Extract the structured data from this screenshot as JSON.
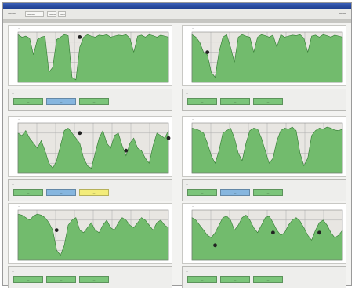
{
  "window": {
    "toolbar": {
      "label": "——",
      "dropdown": "——",
      "button1": "——",
      "button2": "——",
      "right_label": "——"
    }
  },
  "colors": {
    "fill": "#72bb6d",
    "stroke": "#2f7a2f",
    "plot_bg": "#e8e6e2",
    "grid": "#aaaaaa",
    "marker": "#222222",
    "chip_green": "#7bc57a",
    "chip_blue": "#86b6df",
    "chip_yellow": "#f3ec7a"
  },
  "panels": [
    {
      "title": "—",
      "legend_title": "—",
      "chips": [
        {
          "text": "—",
          "color": "chip_green"
        },
        {
          "text": "—",
          "color": "chip_blue"
        },
        {
          "text": "—",
          "color": "chip_green"
        }
      ]
    },
    {
      "title": "—",
      "legend_title": "—",
      "chips": [
        {
          "text": "—",
          "color": "chip_green"
        },
        {
          "text": "—",
          "color": "chip_green"
        },
        {
          "text": "—",
          "color": "chip_green"
        }
      ]
    },
    {
      "title": "—",
      "legend_title": "—",
      "chips": [
        {
          "text": "—",
          "color": "chip_green"
        },
        {
          "text": "—",
          "color": "chip_blue"
        },
        {
          "text": "—",
          "color": "chip_yellow"
        }
      ]
    },
    {
      "title": "—",
      "legend_title": "—",
      "chips": [
        {
          "text": "—",
          "color": "chip_green"
        },
        {
          "text": "—",
          "color": "chip_blue"
        },
        {
          "text": "—",
          "color": "chip_green"
        }
      ]
    },
    {
      "title": "—",
      "legend_title": "—",
      "chips": [
        {
          "text": "—",
          "color": "chip_green"
        },
        {
          "text": "—",
          "color": "chip_green"
        },
        {
          "text": "—",
          "color": "chip_green"
        }
      ]
    },
    {
      "title": "—",
      "legend_title": "—",
      "chips": [
        {
          "text": "—",
          "color": "chip_green"
        },
        {
          "text": "—",
          "color": "chip_green"
        },
        {
          "text": "—",
          "color": "chip_green"
        }
      ]
    }
  ],
  "chart_data": [
    {
      "type": "area",
      "x": [
        0,
        1,
        2,
        3,
        4,
        5,
        6,
        7,
        8,
        9,
        10,
        11,
        12,
        13,
        14,
        15,
        16,
        17,
        18,
        19,
        20,
        21,
        22,
        23,
        24,
        25,
        26,
        27,
        28,
        29,
        30,
        31,
        32,
        33,
        34,
        35,
        36,
        37,
        38,
        39
      ],
      "series": [
        {
          "values": [
            95,
            90,
            92,
            88,
            55,
            85,
            90,
            92,
            20,
            30,
            85,
            90,
            95,
            93,
            10,
            5,
            70,
            90,
            95,
            92,
            90,
            94,
            93,
            95,
            90,
            92,
            94,
            93,
            95,
            88,
            60,
            92,
            94,
            90,
            95,
            93,
            90,
            94,
            92,
            90
          ]
        }
      ],
      "markers": [
        {
          "x": 16,
          "y": 90
        }
      ],
      "ylim": [
        0,
        100
      ]
    },
    {
      "type": "area",
      "x": [
        0,
        1,
        2,
        3,
        4,
        5,
        6,
        7,
        8,
        9,
        10,
        11,
        12,
        13,
        14,
        15,
        16,
        17,
        18,
        19,
        20,
        21,
        22,
        23,
        24,
        25,
        26,
        27,
        28,
        29,
        30,
        31,
        32,
        33,
        34,
        35,
        36,
        37,
        38,
        39
      ],
      "series": [
        {
          "values": [
            95,
            90,
            80,
            60,
            55,
            20,
            10,
            60,
            90,
            95,
            70,
            40,
            90,
            95,
            92,
            90,
            60,
            90,
            95,
            93,
            90,
            94,
            70,
            95,
            90,
            92,
            94,
            93,
            95,
            88,
            60,
            92,
            94,
            90,
            95,
            93,
            90,
            94,
            92,
            90
          ]
        }
      ],
      "markers": [
        {
          "x": 4,
          "y": 60
        }
      ],
      "ylim": [
        0,
        100
      ]
    },
    {
      "type": "area",
      "x": [
        0,
        1,
        2,
        3,
        4,
        5,
        6,
        7,
        8,
        9,
        10,
        11,
        12,
        13,
        14,
        15,
        16,
        17,
        18,
        19,
        20,
        21,
        22,
        23,
        24,
        25,
        26,
        27,
        28,
        29,
        30,
        31,
        32,
        33,
        34,
        35,
        36,
        37,
        38,
        39
      ],
      "series": [
        {
          "values": [
            80,
            75,
            85,
            70,
            60,
            50,
            65,
            45,
            20,
            10,
            25,
            55,
            85,
            90,
            80,
            70,
            60,
            30,
            15,
            10,
            40,
            70,
            85,
            60,
            50,
            75,
            80,
            55,
            35,
            60,
            70,
            50,
            45,
            30,
            20,
            55,
            80,
            75,
            70,
            85
          ]
        }
      ],
      "markers": [
        {
          "x": 16,
          "y": 80
        },
        {
          "x": 28,
          "y": 45
        },
        {
          "x": 39,
          "y": 70
        }
      ],
      "ylim": [
        0,
        100
      ]
    },
    {
      "type": "area",
      "x": [
        0,
        1,
        2,
        3,
        4,
        5,
        6,
        7,
        8,
        9,
        10,
        11,
        12,
        13,
        14,
        15,
        16,
        17,
        18,
        19,
        20,
        21,
        22,
        23,
        24,
        25,
        26,
        27,
        28,
        29,
        30,
        31,
        32,
        33,
        34,
        35,
        36,
        37,
        38,
        39
      ],
      "series": [
        {
          "values": [
            90,
            88,
            85,
            80,
            60,
            35,
            20,
            45,
            80,
            85,
            90,
            70,
            40,
            25,
            60,
            85,
            90,
            88,
            70,
            45,
            20,
            30,
            65,
            85,
            90,
            88,
            92,
            85,
            40,
            15,
            30,
            75,
            85,
            90,
            88,
            92,
            90,
            86,
            85,
            88
          ]
        }
      ],
      "markers": [],
      "ylim": [
        0,
        100
      ]
    },
    {
      "type": "area",
      "x": [
        0,
        1,
        2,
        3,
        4,
        5,
        6,
        7,
        8,
        9,
        10,
        11,
        12,
        13,
        14,
        15,
        16,
        17,
        18,
        19,
        20,
        21,
        22,
        23,
        24,
        25,
        26,
        27,
        28,
        29,
        30,
        31,
        32,
        33,
        34,
        35,
        36,
        37,
        38,
        39
      ],
      "series": [
        {
          "values": [
            92,
            90,
            85,
            80,
            88,
            92,
            90,
            85,
            75,
            60,
            20,
            10,
            30,
            70,
            80,
            85,
            60,
            55,
            65,
            75,
            60,
            55,
            70,
            80,
            65,
            60,
            75,
            85,
            80,
            70,
            65,
            75,
            85,
            80,
            70,
            60,
            75,
            80,
            70,
            65
          ]
        }
      ],
      "markers": [
        {
          "x": 10,
          "y": 60
        }
      ],
      "ylim": [
        0,
        100
      ]
    },
    {
      "type": "area",
      "x": [
        0,
        1,
        2,
        3,
        4,
        5,
        6,
        7,
        8,
        9,
        10,
        11,
        12,
        13,
        14,
        15,
        16,
        17,
        18,
        19,
        20,
        21,
        22,
        23,
        24,
        25,
        26,
        27,
        28,
        29,
        30,
        31,
        32,
        33,
        34,
        35,
        36,
        37,
        38,
        39
      ],
      "series": [
        {
          "values": [
            85,
            80,
            70,
            60,
            50,
            45,
            55,
            70,
            85,
            88,
            80,
            60,
            70,
            85,
            90,
            80,
            65,
            55,
            70,
            85,
            88,
            75,
            60,
            50,
            55,
            70,
            80,
            85,
            78,
            65,
            50,
            40,
            60,
            75,
            80,
            70,
            55,
            45,
            50,
            60
          ]
        }
      ],
      "markers": [
        {
          "x": 6,
          "y": 30
        },
        {
          "x": 21,
          "y": 55
        },
        {
          "x": 33,
          "y": 55
        }
      ],
      "ylim": [
        0,
        100
      ]
    }
  ]
}
